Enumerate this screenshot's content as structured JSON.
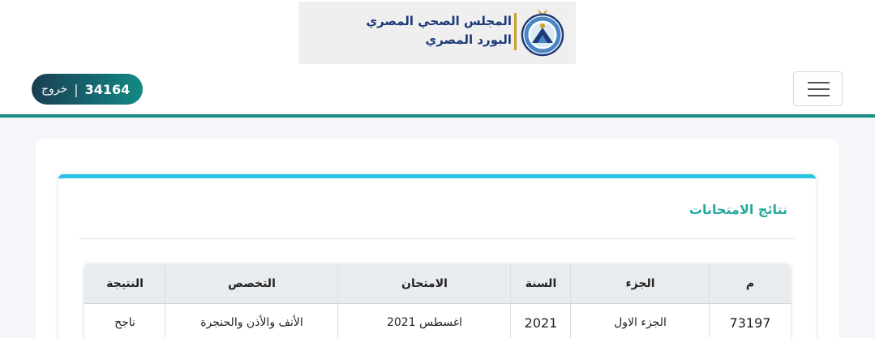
{
  "header": {
    "logo_line1": "المجلس الصحي المصري",
    "logo_line2": "البورد المصري",
    "emblem_icon": "egyptian-medical-council-emblem",
    "user_id": "34164",
    "separator": "|",
    "logout_label": "خروج",
    "menu_icon": "hamburger-icon"
  },
  "colors": {
    "accent_teal": "#158c84",
    "card_top_border": "#29c4e0",
    "title_color": "#26a99d",
    "logo_text": "#1d3a78",
    "logo_gold": "#c9a227"
  },
  "main": {
    "title": "نتائج الامتحانات",
    "table": {
      "headers": {
        "index": "م",
        "part": "الجزء",
        "year": "السنة",
        "exam": "الامتحان",
        "specialty": "التخصص",
        "result": "النتيجة"
      },
      "rows": [
        {
          "index": "73197",
          "part": "الجزء الاول",
          "year": "2021",
          "exam": "اغسطس 2021",
          "specialty": "الأنف والأذن والحنجرة",
          "result": "ناجح"
        }
      ]
    }
  }
}
